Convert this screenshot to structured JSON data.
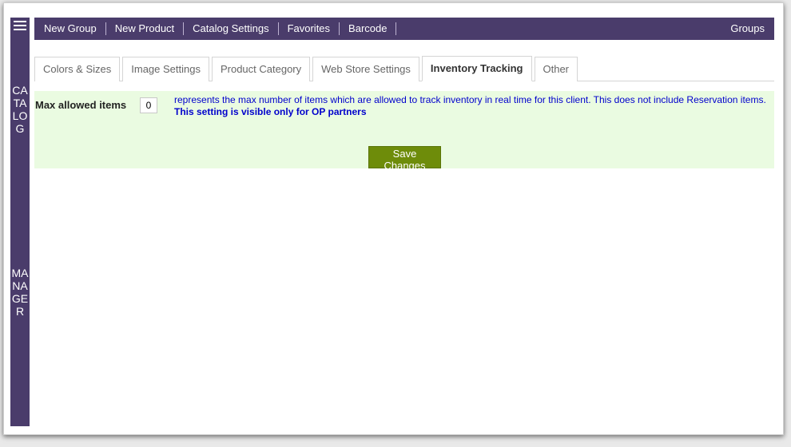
{
  "sidebar": {
    "vertical_label_1": "CATALOG",
    "vertical_label_2": "MANAGER"
  },
  "topnav": {
    "items": [
      "New Group",
      "New Product",
      "Catalog Settings",
      "Favorites",
      "Barcode"
    ],
    "right_item": "Groups"
  },
  "tabs": [
    {
      "label": "Colors & Sizes",
      "active": false
    },
    {
      "label": "Image Settings",
      "active": false
    },
    {
      "label": "Product Category",
      "active": false
    },
    {
      "label": "Web Store Settings",
      "active": false
    },
    {
      "label": "Inventory Tracking",
      "active": true
    },
    {
      "label": "Other",
      "active": false
    }
  ],
  "panel": {
    "field_label": "Max allowed items",
    "field_value": "0",
    "description": "represents the max number of items which are allowed to track inventory in real time for this client. This does not include Reservation items.",
    "description_bold": "This setting is visible only for OP partners",
    "save_label": "Save Changes"
  },
  "colors": {
    "nav_bg": "#4a3c6b",
    "panel_bg": "#eafbe1",
    "save_button": "#6e8c0a",
    "description_text": "#0000cc"
  },
  "icons": {
    "menu": "hamburger-menu-icon"
  }
}
